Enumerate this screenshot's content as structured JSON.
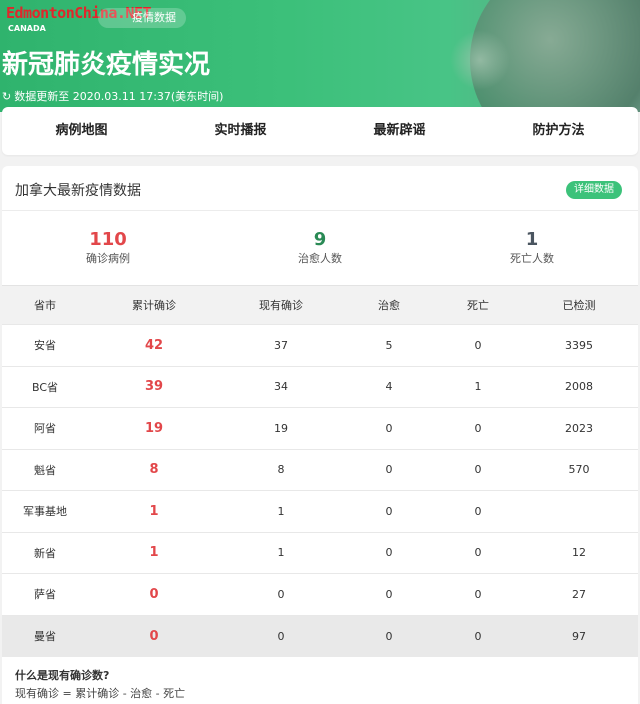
{
  "header": {
    "site_logo": "EdmontonChina.NET",
    "logo_sub": "CANADA",
    "crumb": "疫情数据",
    "title": "新冠肺炎疫情实况",
    "update_text": "数据更新至 2020.03.11 17:37(美东时间)"
  },
  "nav": {
    "items": [
      "病例地图",
      "实时播报",
      "最新辟谣",
      "防护方法"
    ]
  },
  "card": {
    "title": "加拿大最新疫情数据",
    "detail_button": "详细数据",
    "summary": [
      {
        "value": "110",
        "label": "确诊病例"
      },
      {
        "value": "9",
        "label": "治愈人数"
      },
      {
        "value": "1",
        "label": "死亡人数"
      }
    ],
    "table": {
      "headers": [
        "省市",
        "累计确诊",
        "现有确诊",
        "治愈",
        "死亡",
        "已检测"
      ],
      "rows": [
        [
          "安省",
          "42",
          "37",
          "5",
          "0",
          "3395"
        ],
        [
          "BC省",
          "39",
          "34",
          "4",
          "1",
          "2008"
        ],
        [
          "阿省",
          "19",
          "19",
          "0",
          "0",
          "2023"
        ],
        [
          "魁省",
          "8",
          "8",
          "0",
          "0",
          "570"
        ],
        [
          "军事基地",
          "1",
          "1",
          "0",
          "0",
          ""
        ],
        [
          "新省",
          "1",
          "1",
          "0",
          "0",
          "12"
        ],
        [
          "萨省",
          "0",
          "0",
          "0",
          "0",
          "27"
        ],
        [
          "曼省",
          "0",
          "0",
          "0",
          "0",
          "97"
        ]
      ]
    },
    "note": {
      "question": "什么是现有确诊数?",
      "answer": "现有确诊 = 累计确诊 - 治愈 - 死亡"
    }
  },
  "colors": {
    "accent_green": "#3cc27a",
    "confirm_red": "#e2474a",
    "cured_green": "#2a8a55",
    "death_gray": "#4a5560"
  }
}
